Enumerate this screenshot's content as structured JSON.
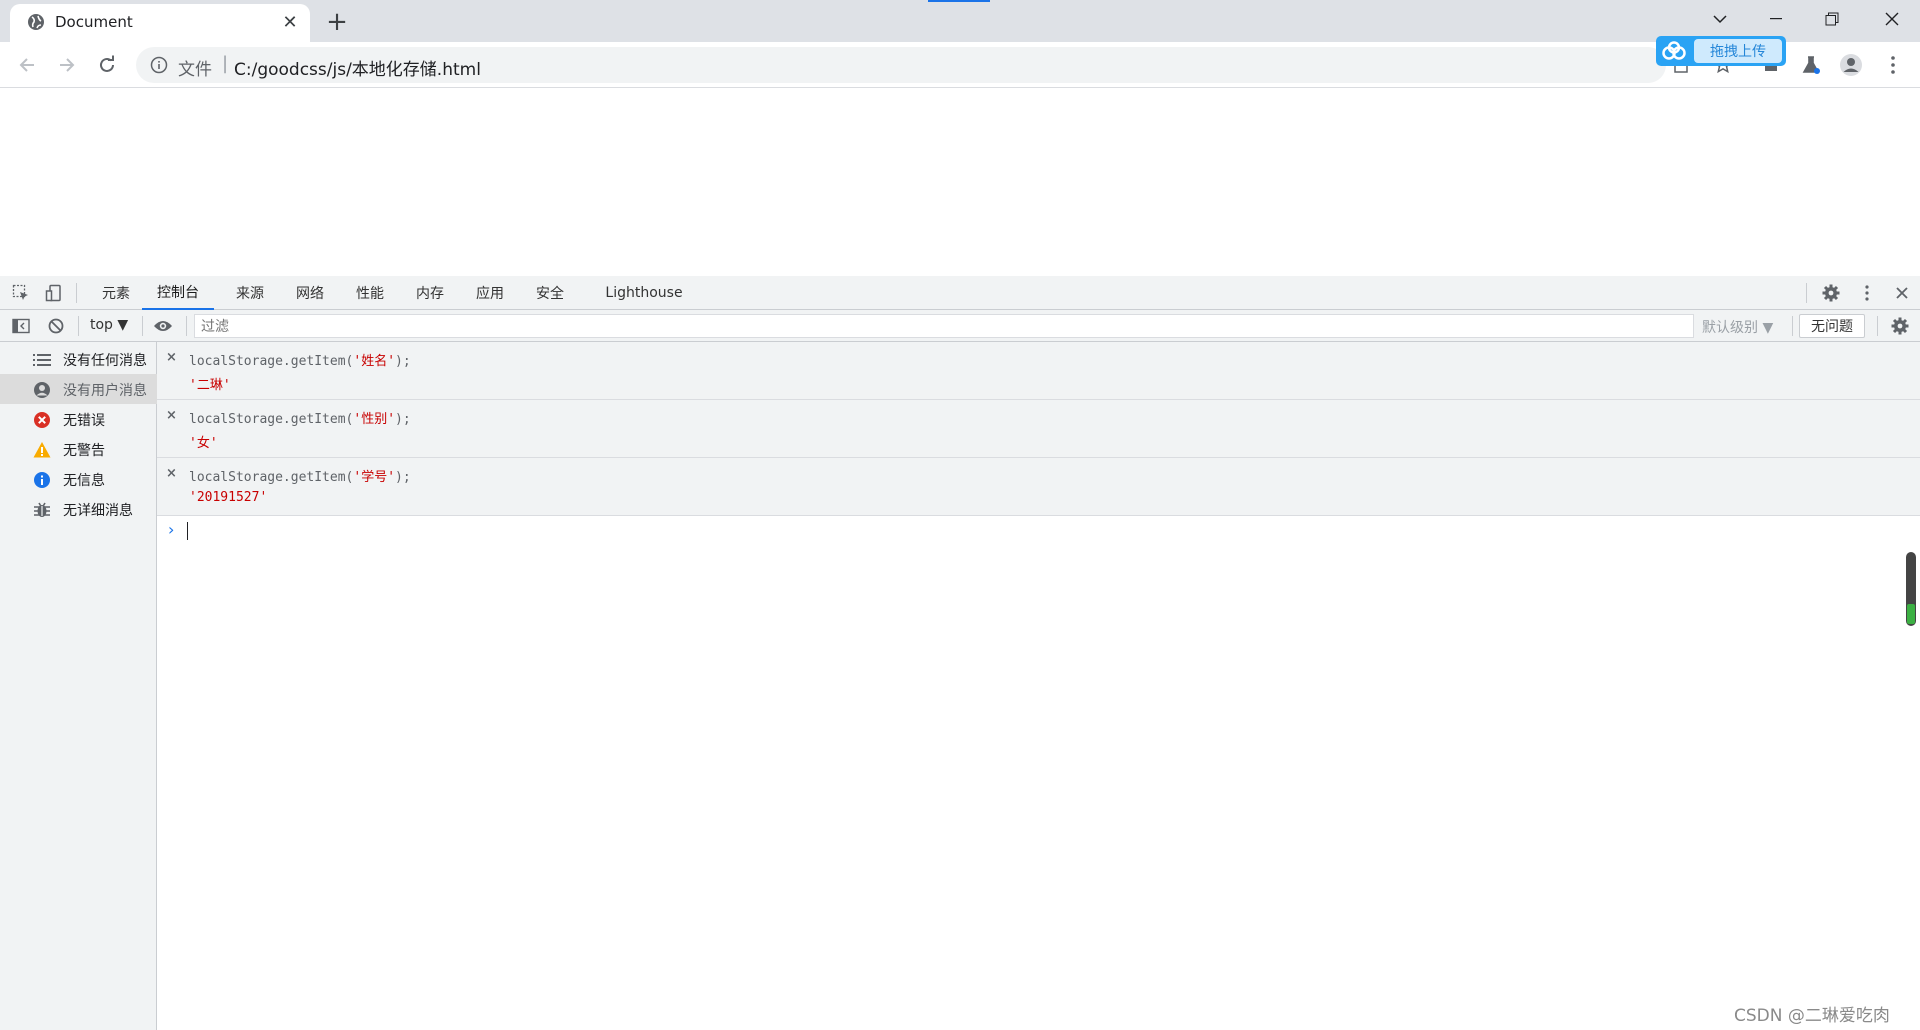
{
  "browser": {
    "tab_title": "Document",
    "tab_close": "✕",
    "new_tab": "+",
    "omnibox": {
      "scheme_label": "文件",
      "separator": "|",
      "url": "C:/goodcss/js/本地化存储.html"
    },
    "upload_button_label": "拖拽上传"
  },
  "devtools": {
    "tabs": [
      "元素",
      "控制台",
      "来源",
      "网络",
      "性能",
      "内存",
      "应用",
      "安全",
      "Lighthouse"
    ],
    "active_tab": "控制台",
    "context": "top ▼",
    "filter_placeholder": "过滤",
    "level_label": "默认级别 ▼",
    "issues_label": "无问题",
    "sidebar": [
      {
        "label": "没有任何消息",
        "icon": "list-icon"
      },
      {
        "label": "没有用户消息",
        "icon": "user-icon",
        "selected": true
      },
      {
        "label": "无错误",
        "icon": "error-icon",
        "color": "#d93025"
      },
      {
        "label": "无警告",
        "icon": "warning-icon",
        "color": "#f9ab00"
      },
      {
        "label": "无信息",
        "icon": "info-icon",
        "color": "#1a73e8"
      },
      {
        "label": "无详细消息",
        "icon": "bug-icon"
      }
    ],
    "entries": [
      {
        "cmd_prefix": "localStorage.getItem(",
        "cmd_arg": "'姓名'",
        "cmd_suffix": ");",
        "result": "'二琳'"
      },
      {
        "cmd_prefix": "localStorage.getItem(",
        "cmd_arg": "'性别'",
        "cmd_suffix": ");",
        "result": "'女'"
      },
      {
        "cmd_prefix": "localStorage.getItem(",
        "cmd_arg": "'学号'",
        "cmd_suffix": ");",
        "result": "'20191527'"
      }
    ],
    "entry_marker": "×",
    "prompt": "›"
  },
  "watermark": "CSDN @二琳爱吃肉"
}
